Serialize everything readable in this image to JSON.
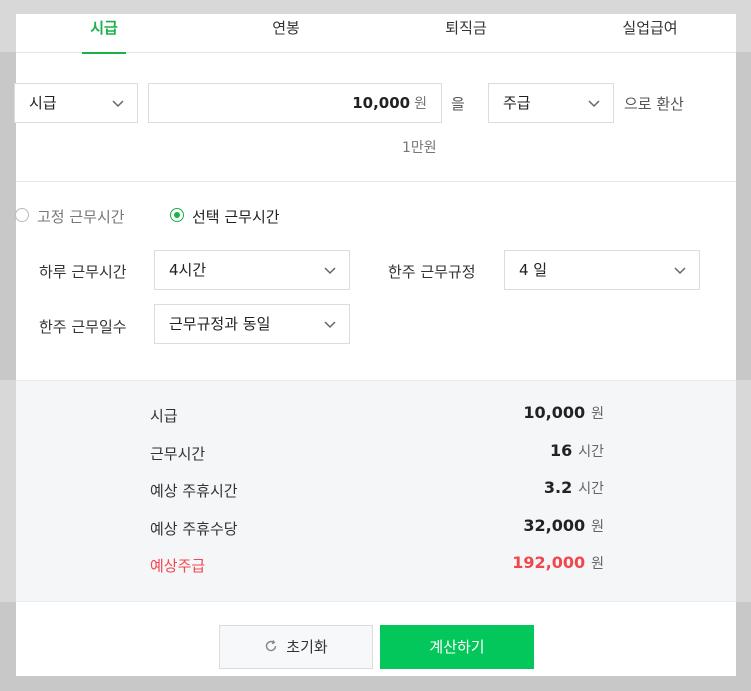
{
  "tabs": [
    {
      "label": "시급",
      "active": true
    },
    {
      "label": "연봉",
      "active": false
    },
    {
      "label": "퇴직금",
      "active": false
    },
    {
      "label": "실업급여",
      "active": false
    }
  ],
  "converter": {
    "from_unit": "시급",
    "amount": "10,000",
    "amount_unit": "원",
    "particle": "을",
    "to_unit": "주급",
    "suffix": "으로 환산",
    "amount_hint": "1만원"
  },
  "work_mode": {
    "options": [
      {
        "label": "고정 근무시간",
        "selected": false
      },
      {
        "label": "선택 근무시간",
        "selected": true
      }
    ]
  },
  "fields": {
    "daily_hours": {
      "label": "하루 근무시간",
      "value": "4시간"
    },
    "weekly_rule": {
      "label": "한주 근무규정",
      "value": "4 일"
    },
    "weekly_days": {
      "label": "한주 근무일수",
      "value": "근무규정과 동일"
    }
  },
  "results": [
    {
      "label": "시급",
      "value": "10,000",
      "unit": "원",
      "highlight": false
    },
    {
      "label": "근무시간",
      "value": "16",
      "unit": "시간",
      "highlight": false
    },
    {
      "label": "예상 주휴시간",
      "value": "3.2",
      "unit": "시간",
      "highlight": false
    },
    {
      "label": "예상 주휴수당",
      "value": "32,000",
      "unit": "원",
      "highlight": false
    },
    {
      "label": "예상주급",
      "value": "192,000",
      "unit": "원",
      "highlight": true
    }
  ],
  "buttons": {
    "reset": "초기화",
    "calculate": "계산하기"
  },
  "colors": {
    "accent": "#19b24a",
    "primary_button": "#03c75a",
    "highlight": "#f2464f"
  }
}
